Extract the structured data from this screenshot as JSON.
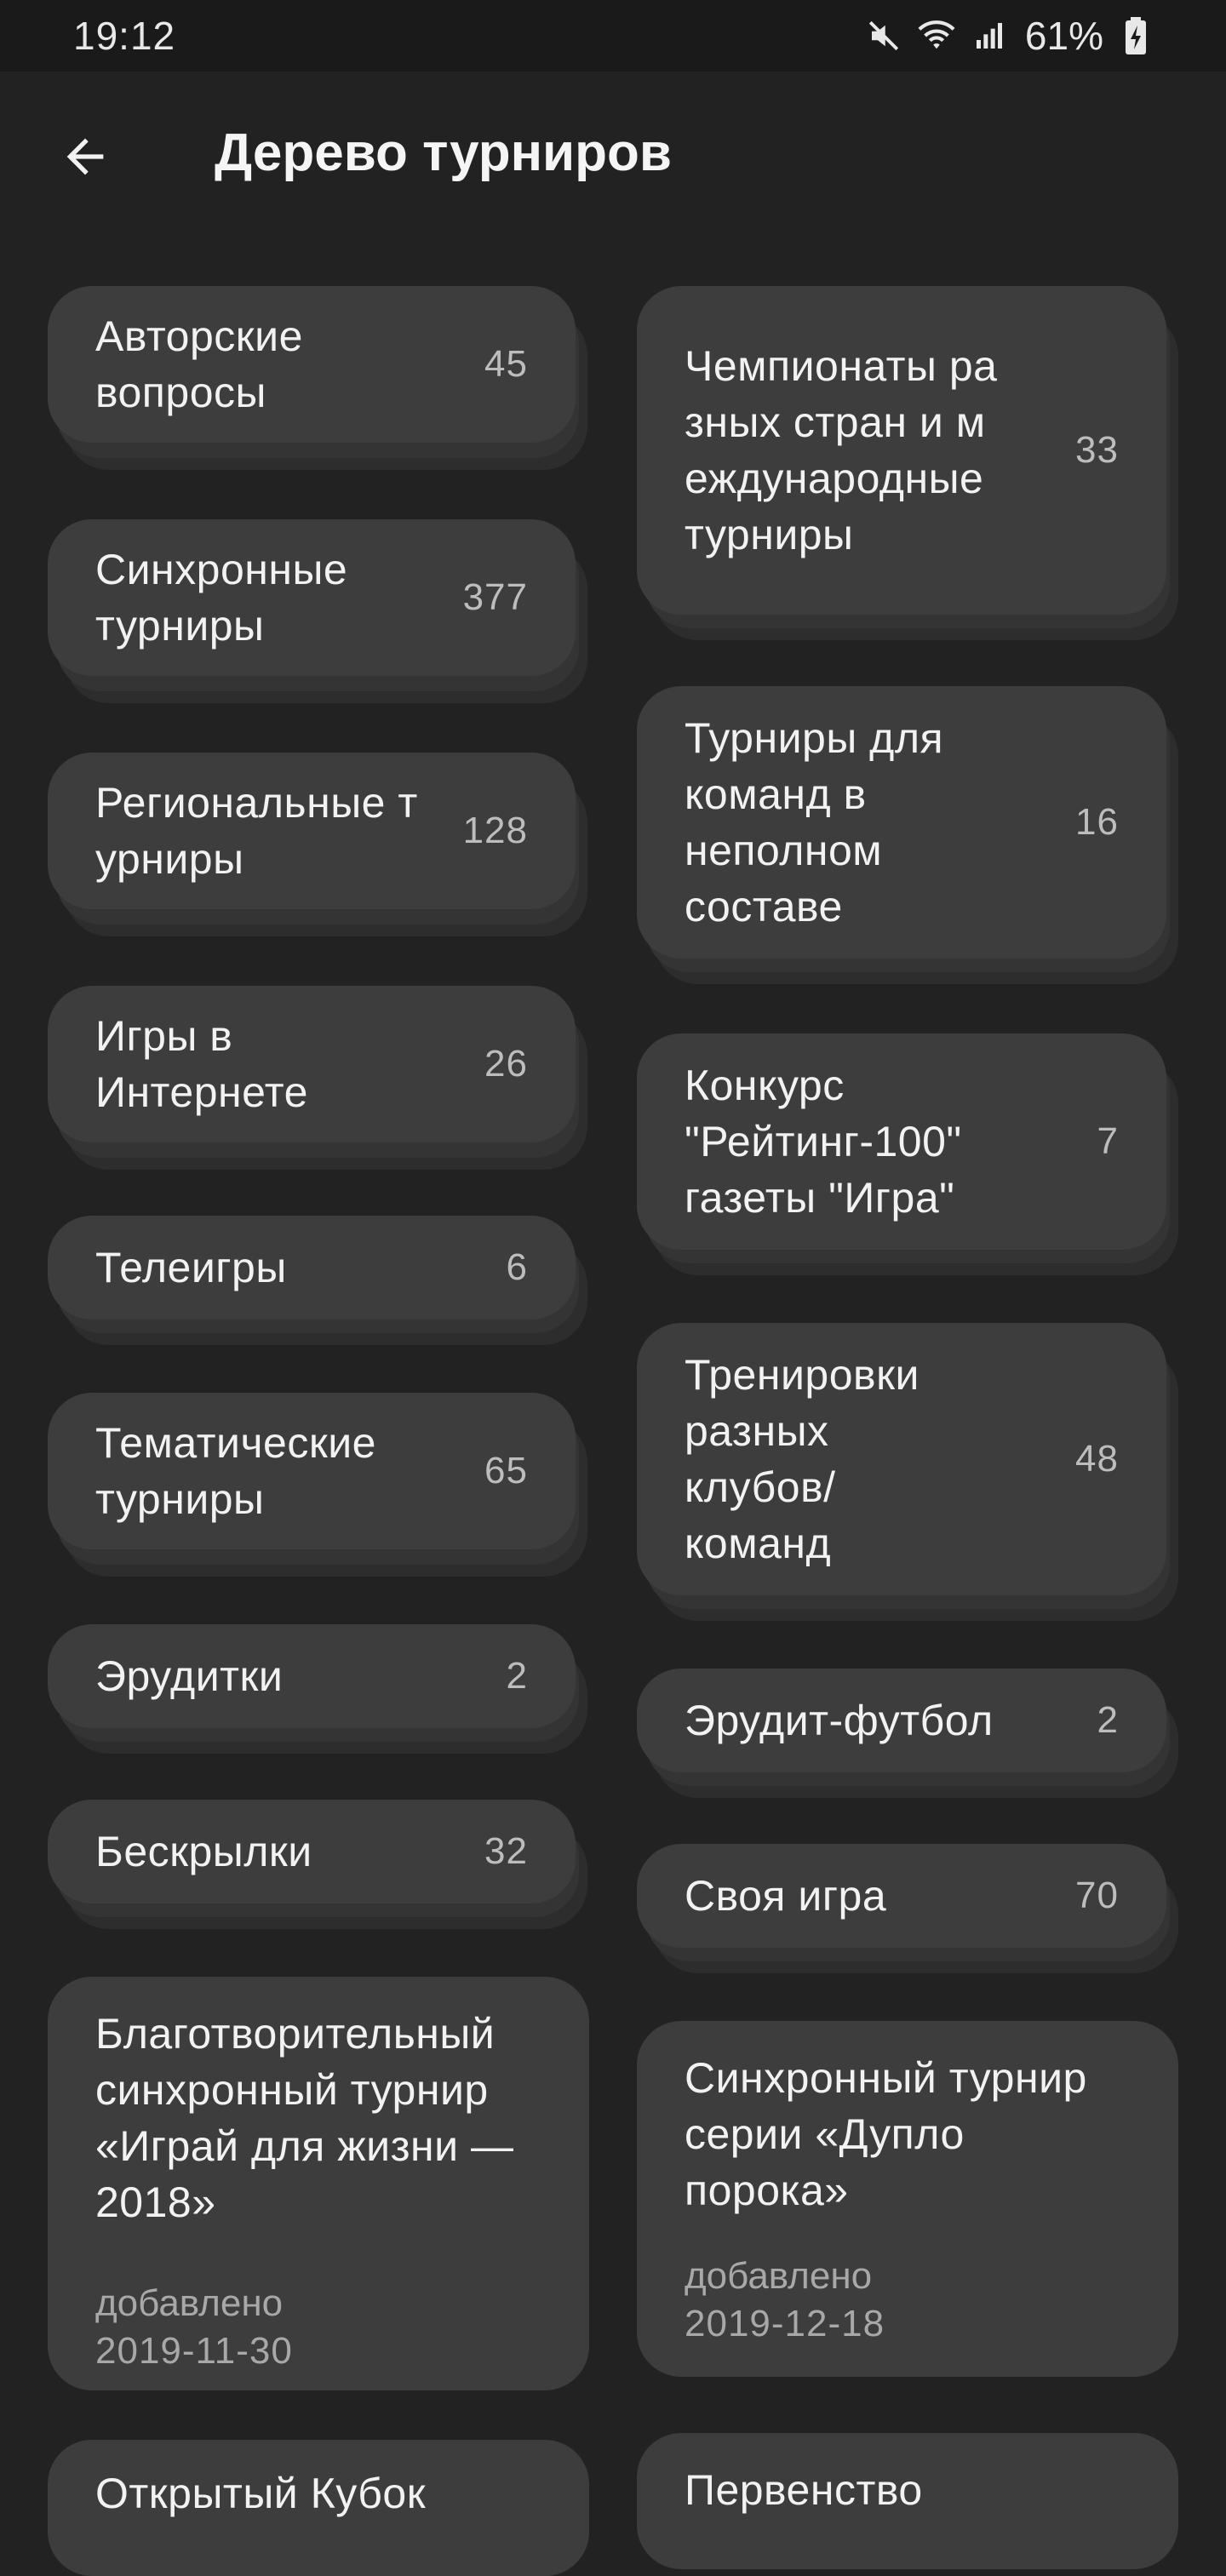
{
  "status_bar": {
    "time": "19:12",
    "battery_text": "61%",
    "icons": [
      "mute-icon",
      "wifi-icon",
      "signal-icon",
      "battery-charging-icon"
    ]
  },
  "app_bar": {
    "back_icon": "arrow-left-icon",
    "title": "Дерево турниров"
  },
  "left_column": [
    {
      "title": "Авторские вопросы",
      "count": "45"
    },
    {
      "title": "Синхронные турниры",
      "count": "377"
    },
    {
      "title": "Региональные турниры",
      "count": "128"
    },
    {
      "title": "Игры в Интернете",
      "count": "26"
    },
    {
      "title": "Телеигры",
      "count": "6"
    },
    {
      "title": "Тематические турниры",
      "count": "65"
    },
    {
      "title": "Эрудитки",
      "count": "2"
    },
    {
      "title": "Бескрылки",
      "count": "32"
    }
  ],
  "right_column": [
    {
      "title": "Чемпионаты разных стран и международные турниры",
      "count": "33"
    },
    {
      "title": "Турниры для команд в неполном составе",
      "count": "16"
    },
    {
      "title": "Конкурс \"Рейтинг-100\" газеты \"Игра\"",
      "count": "7"
    },
    {
      "title": "Тренировки разных клубов/команд",
      "count": "48"
    },
    {
      "title": "Эрудит-футбол",
      "count": "2"
    },
    {
      "title": "Своя игра",
      "count": "70"
    }
  ],
  "tournaments": [
    {
      "title": "Благотворительный синхронный турнир «Играй для жизни — 2018»",
      "added_label": "добавлено",
      "added_date": "2019-11-30"
    },
    {
      "title": "Синхронный турнир серии «Дупло порока»",
      "added_label": "добавлено",
      "added_date": "2019-12-18"
    },
    {
      "title": "Открытый Кубок",
      "added_label": "",
      "added_date": ""
    },
    {
      "title": "Первенство",
      "added_label": "",
      "added_date": ""
    }
  ],
  "colors": {
    "background": "#222222",
    "card": "#3d3d3d",
    "text": "#f2f2f2",
    "count": "#bdbdbd"
  }
}
